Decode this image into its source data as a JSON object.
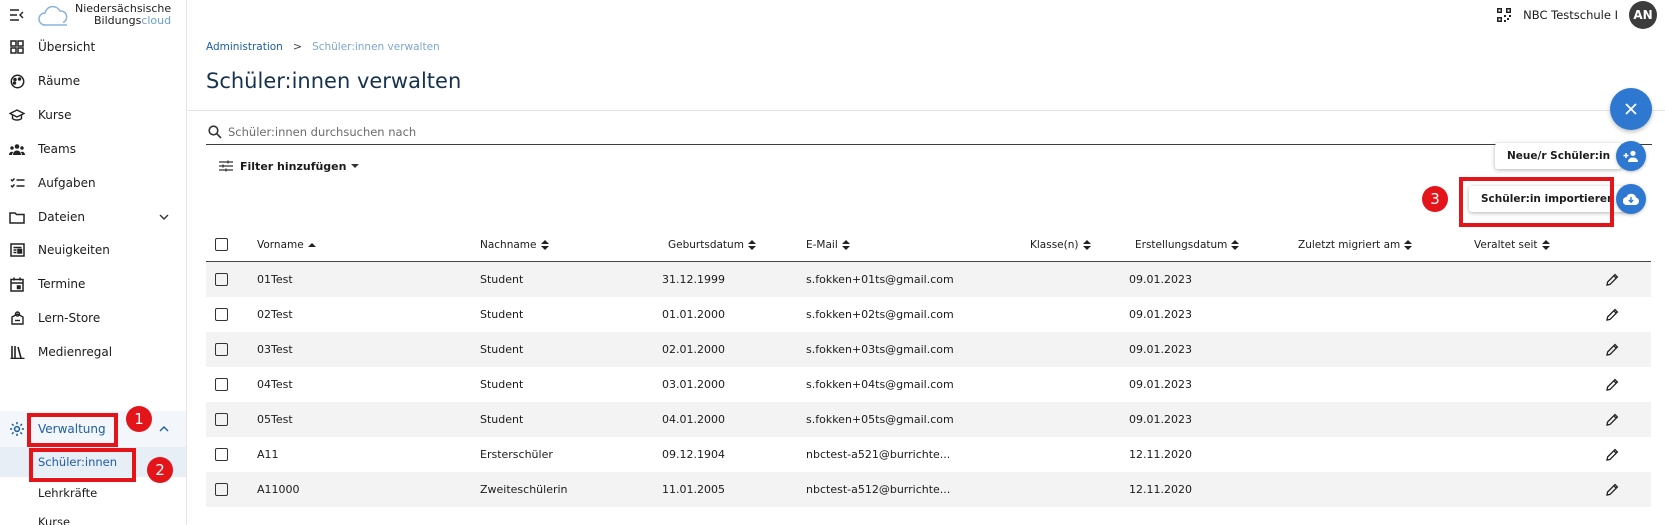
{
  "logo": {
    "line1": "Niedersächsische",
    "line2a": "Bildungs",
    "line2b": "cloud"
  },
  "header": {
    "school": "NBC Testschule I",
    "avatar": "AN"
  },
  "sidebar": {
    "items": [
      {
        "label": "Übersicht",
        "icon": "grid-icon"
      },
      {
        "label": "Räume",
        "icon": "palette-icon"
      },
      {
        "label": "Kurse",
        "icon": "school-hat-icon"
      },
      {
        "label": "Teams",
        "icon": "group-icon"
      },
      {
        "label": "Aufgaben",
        "icon": "task-list-icon"
      },
      {
        "label": "Dateien",
        "icon": "folder-icon"
      },
      {
        "label": "Neuigkeiten",
        "icon": "news-icon"
      },
      {
        "label": "Termine",
        "icon": "calendar-icon"
      },
      {
        "label": "Lern-Store",
        "icon": "store-icon"
      },
      {
        "label": "Medienregal",
        "icon": "bookshelf-icon"
      },
      {
        "label": "Verwaltung",
        "icon": "gear-icon"
      }
    ],
    "subitems": [
      "Schüler:innen",
      "Lehrkräfte",
      "Kurse"
    ]
  },
  "breadcrumb": {
    "link": "Administration",
    "sep": ">",
    "current": "Schüler:innen verwalten"
  },
  "page": {
    "title": "Schüler:innen verwalten"
  },
  "search": {
    "placeholder": "Schüler:innen durchsuchen nach"
  },
  "filter": {
    "label": "Filter hinzufügen"
  },
  "fab": {
    "new_label": "Neue/r Schüler:in",
    "import_label": "Schüler:in importieren"
  },
  "annotations": [
    "1",
    "2",
    "3"
  ],
  "table": {
    "headers": [
      "Vorname",
      "Nachname",
      "Geburtsdatum",
      "E-Mail",
      "Klasse(n)",
      "Erstellungsdatum",
      "Zuletzt migriert am",
      "Veraltet seit"
    ],
    "rows": [
      [
        "01Test",
        "Student",
        "31.12.1999",
        "s.fokken+01ts@gmail.com",
        "",
        "09.01.2023"
      ],
      [
        "02Test",
        "Student",
        "01.01.2000",
        "s.fokken+02ts@gmail.com",
        "",
        "09.01.2023"
      ],
      [
        "03Test",
        "Student",
        "02.01.2000",
        "s.fokken+03ts@gmail.com",
        "",
        "09.01.2023"
      ],
      [
        "04Test",
        "Student",
        "03.01.2000",
        "s.fokken+04ts@gmail.com",
        "",
        "09.01.2023"
      ],
      [
        "05Test",
        "Student",
        "04.01.2000",
        "s.fokken+05ts@gmail.com",
        "",
        "09.01.2023"
      ],
      [
        "A11",
        "Ersterschüler",
        "09.12.1904",
        "nbctest-a521@burrichte...",
        "",
        "12.11.2020"
      ],
      [
        "A11000",
        "Zweiteschülerin",
        "11.01.2005",
        "nbctest-a512@burrichte...",
        "",
        "12.11.2020"
      ]
    ]
  },
  "colors": {
    "primary": "#2e78d2",
    "link": "#1d5ea8",
    "annotation": "#e4141b"
  }
}
